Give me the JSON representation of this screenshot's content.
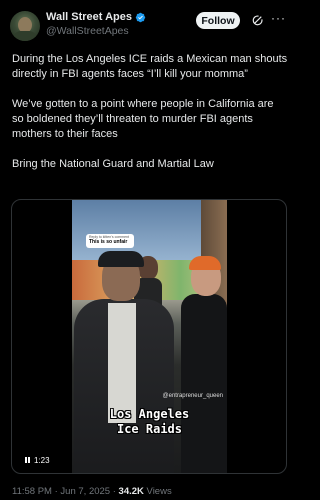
{
  "author": {
    "display_name": "Wall Street Apes",
    "handle": "@WallStreetApes"
  },
  "header": {
    "follow_label": "Follow",
    "more_label": "···"
  },
  "tweet": {
    "paragraphs": [
      "During the Los Angeles ICE raids a Mexican man shouts directly in FBI agents faces “I’ll kill your momma”",
      "We’ve gotten to a point where people in California are so boldened they’ll threaten to murder FBI agents mothers to their faces",
      "Bring the National Guard and Martial Law"
    ]
  },
  "media": {
    "sticker_top": "Reply to kitten's comment",
    "sticker_text": "This is so unfair",
    "watermark": "@entrapreneur_queen",
    "caption_line1": "Los Angeles",
    "caption_line2": "Ice Raids",
    "duration": "1:23"
  },
  "meta": {
    "time": "11:58 PM",
    "separator": " · ",
    "date": "Jun 7, 2025",
    "views_count": "34.2K",
    "views_label": " Views"
  },
  "colors": {
    "background": "#000000",
    "text_primary": "#e7e9ea",
    "text_secondary": "#71767b",
    "verified": "#1d9bf0",
    "follow_bg": "#eff3f4"
  },
  "icons": {
    "verified": "verified-badge-icon",
    "grok": "grok-icon",
    "more": "more-icon",
    "pause": "pause-icon"
  }
}
